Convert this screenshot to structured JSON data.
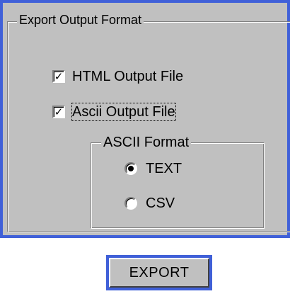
{
  "export_group": {
    "title": "Export Output Format",
    "html_output": {
      "label": "HTML Output File",
      "checked": true
    },
    "ascii_output": {
      "label": "Ascii Output File",
      "checked": true
    },
    "ascii_format": {
      "title": "ASCII  Format",
      "options": [
        {
          "label": "TEXT",
          "selected": true
        },
        {
          "label": "CSV",
          "selected": false
        }
      ]
    }
  },
  "export_button": {
    "label": "EXPORT"
  },
  "colors": {
    "panel_bg": "#c0c0c0",
    "accent_border": "#4060d8"
  },
  "icons": {
    "checkbox_check": "check-icon",
    "radio_dot": "radio-dot-icon"
  }
}
